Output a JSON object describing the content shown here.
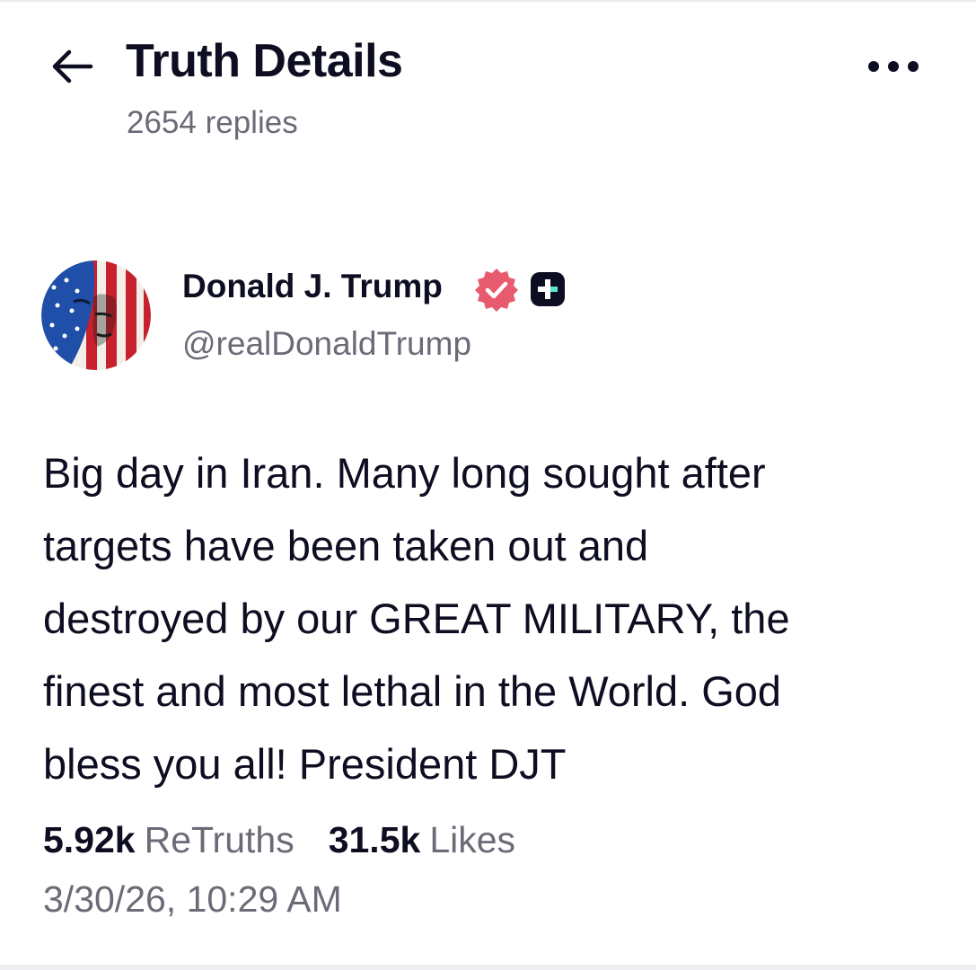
{
  "header": {
    "title": "Truth Details",
    "subtitle": "2654 replies",
    "back_icon": "arrow-left-icon",
    "more_icon": "more-horizontal-icon"
  },
  "post": {
    "author": {
      "display_name": "Donald J. Trump",
      "handle": "@realDonaldTrump",
      "verified_icon": "verified-badge-icon",
      "verified_color": "#e85a6e",
      "extra_badge_icon": "truth-plus-icon"
    },
    "body": "Big day in Iran. Many long sought after\ntargets have been taken out and\ndestroyed by our GREAT MILITARY, the\nfinest and most lethal in the World. God\nbless you all! President DJT",
    "stats": {
      "retruths_count": "5.92k",
      "retruths_label": "ReTruths",
      "likes_count": "31.5k",
      "likes_label": "Likes"
    },
    "timestamp": "3/30/26, 10:29 AM"
  },
  "colors": {
    "text_primary": "#0e0e22",
    "text_secondary": "#6b6b78",
    "background": "#ffffff"
  }
}
